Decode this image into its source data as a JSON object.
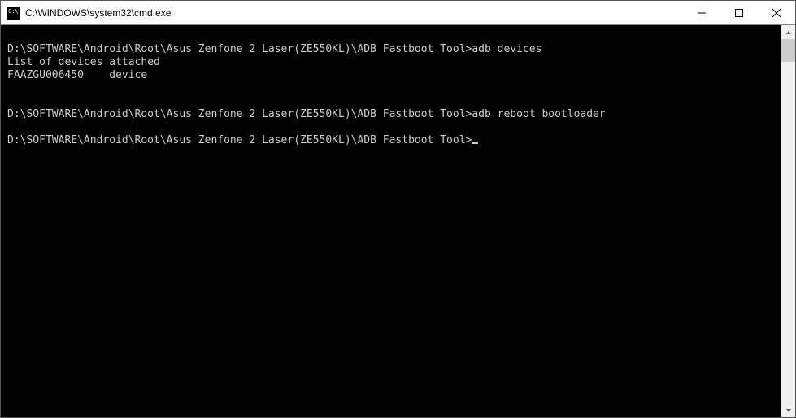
{
  "window": {
    "title": "C:\\WINDOWS\\system32\\cmd.exe"
  },
  "terminal": {
    "prompt": "D:\\SOFTWARE\\Android\\Root\\Asus Zenfone 2 Laser(ZE550KL)\\ADB Fastboot Tool>",
    "lines": [
      "",
      "D:\\SOFTWARE\\Android\\Root\\Asus Zenfone 2 Laser(ZE550KL)\\ADB Fastboot Tool>adb devices",
      "List of devices attached",
      "FAAZGU006450    device",
      "",
      "",
      "D:\\SOFTWARE\\Android\\Root\\Asus Zenfone 2 Laser(ZE550KL)\\ADB Fastboot Tool>adb reboot bootloader",
      "",
      "D:\\SOFTWARE\\Android\\Root\\Asus Zenfone 2 Laser(ZE550KL)\\ADB Fastboot Tool>"
    ]
  }
}
